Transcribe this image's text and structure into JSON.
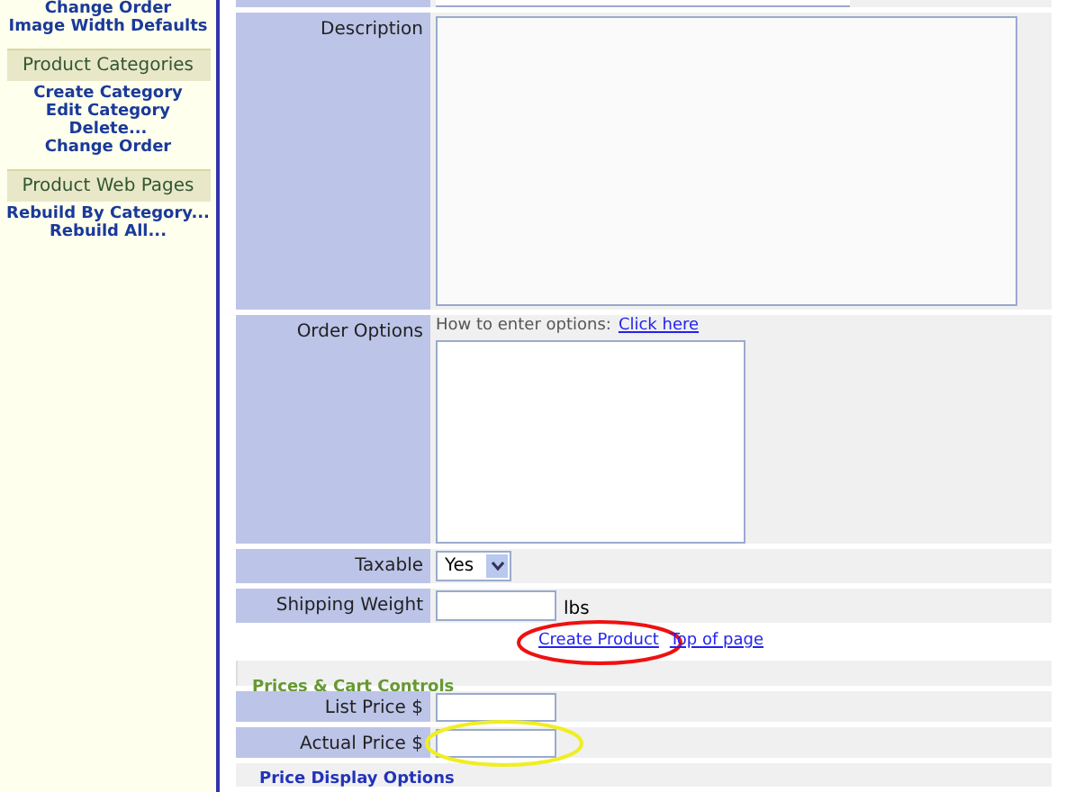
{
  "sidebar": {
    "groups": [
      {
        "links": [
          "Change Order",
          "Image Width Defaults"
        ]
      },
      {
        "title": "Product Categories",
        "links": [
          "Create Category",
          "Edit Category",
          "Delete...",
          "Change Order"
        ]
      },
      {
        "title": "Product Web Pages",
        "links": [
          "Rebuild By Category...",
          "Rebuild All..."
        ]
      }
    ]
  },
  "form": {
    "description_label": "Description",
    "order_options": {
      "label": "Order Options",
      "hint": "How to enter options:",
      "link": "Click here"
    },
    "taxable": {
      "label": "Taxable",
      "value": "Yes"
    },
    "shipping_weight": {
      "label": "Shipping Weight",
      "unit": "lbs"
    },
    "links": [
      "Create Product",
      "Top of page"
    ],
    "prices_heading": "Prices & Cart Controls",
    "price_fields": [
      "List Price $",
      "Actual Price $"
    ],
    "display_heading": "Price Display Options"
  }
}
